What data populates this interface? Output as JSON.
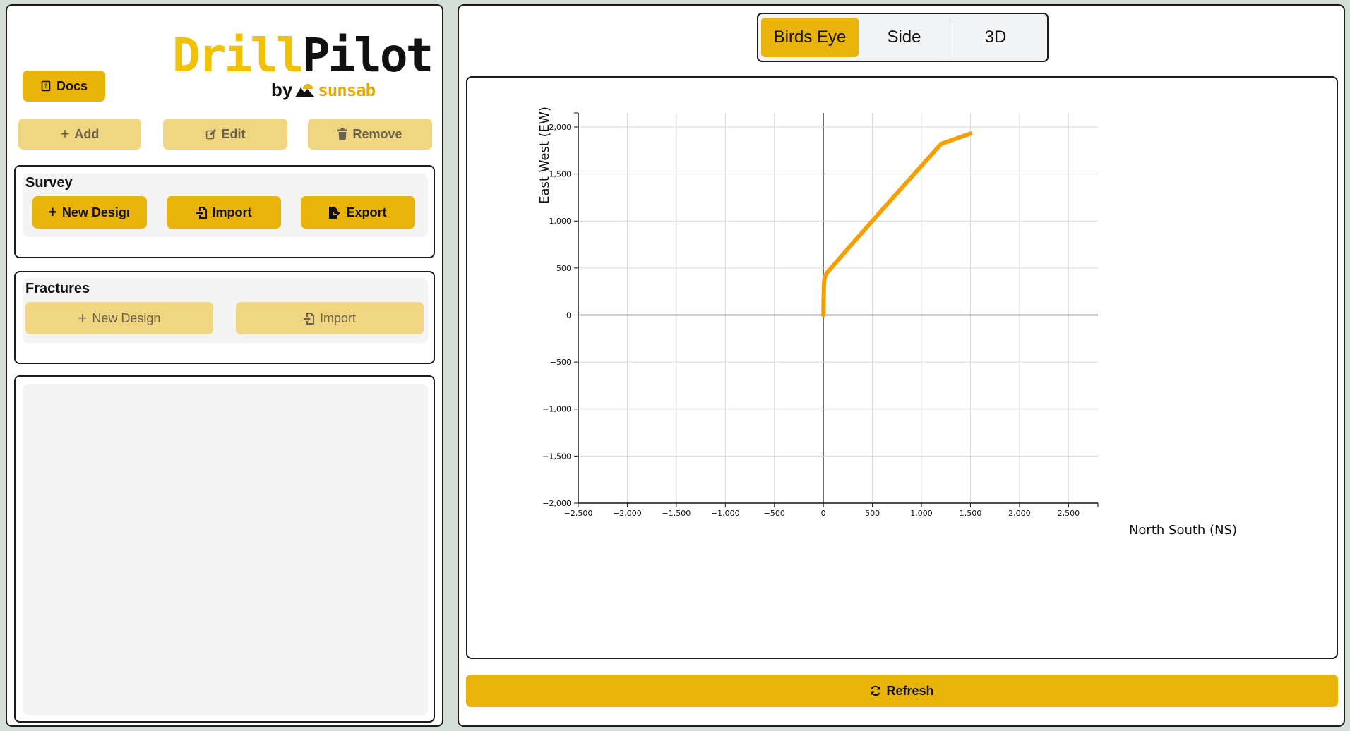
{
  "logo": {
    "drill": "Drill",
    "pilot": "Pilot",
    "by": "by",
    "brand": "sunsab"
  },
  "toolbar": {
    "docs_label": "Docs",
    "add_label": "Add",
    "edit_label": "Edit",
    "remove_label": "Remove"
  },
  "survey": {
    "title": "Survey",
    "new_design_label": "New Desigı",
    "import_label": "Import",
    "export_label": "Export"
  },
  "fractures": {
    "title": "Fractures",
    "new_design_label": "New Design",
    "import_label": "Import"
  },
  "view_tabs": [
    "Birds Eye",
    "Side",
    "3D"
  ],
  "active_tab": "Birds Eye",
  "refresh_label": "Refresh",
  "colors": {
    "accent": "#e9b30a",
    "accent_disabled": "#f0d680",
    "series": "#f5a000"
  },
  "chart_data": {
    "type": "line",
    "title": "",
    "xlabel": "North South (NS)",
    "ylabel": "East West (EW)",
    "xlim": [
      -2500,
      2800
    ],
    "ylim": [
      -2000,
      2150
    ],
    "x_ticks": [
      -2500,
      -2000,
      -1500,
      -1000,
      -500,
      0,
      500,
      1000,
      1500,
      2000,
      2500
    ],
    "x_tick_labels": [
      "−2,500",
      "−2,000",
      "−1,500",
      "−1,000",
      "−500",
      "0",
      "500",
      "1,000",
      "1,500",
      "2,000",
      "2,500"
    ],
    "y_ticks": [
      -2000,
      -1500,
      -1000,
      -500,
      0,
      500,
      1000,
      1500,
      2000
    ],
    "y_tick_labels": [
      "−2,000",
      "−1,500",
      "−1,000",
      "−500",
      "0",
      "500",
      "1,000",
      "1,500",
      "2,000"
    ],
    "grid": true,
    "series": [
      {
        "x": [
          0,
          2,
          5,
          10,
          20,
          40,
          70,
          300,
          600,
          900,
          1200,
          1500
        ],
        "y": [
          0,
          150,
          300,
          380,
          420,
          455,
          490,
          765,
          1120,
          1470,
          1820,
          1930
        ]
      }
    ]
  }
}
